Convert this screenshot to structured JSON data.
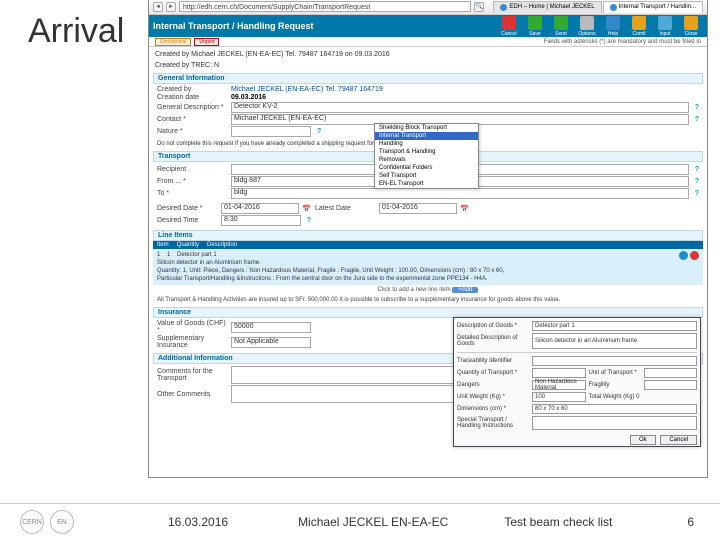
{
  "slide": {
    "title": "Arrival"
  },
  "browser": {
    "url": "http://edh.cern.ch/Document/SupplyChain/TransportRequest",
    "tab1": "EDH – Home | Michael JECKEL",
    "tab2": "Internal Transport / Handlin...",
    "pageTitle": "Internal Transport / Handling Request"
  },
  "toolbarButtons": [
    "Cancel",
    "Save",
    "Send",
    "Options",
    "Help",
    "Comfi",
    "Input",
    "Close"
  ],
  "legend": {
    "confidential": "Confidential",
    "urgent": "Urgent",
    "hint": "Fields with asterisks (*) are mandatory and must be filled in"
  },
  "createdLine": "Created by Michael JECKEL (EN-EA-EC)  Tel. 79487 164719 on 09.03.2016",
  "createdByTrec": "Created by TREC: N",
  "sections": {
    "general": "General Information",
    "transport": "Transport",
    "lineItems": "Line Items",
    "insurance": "Insurance",
    "additional": "Additional Information"
  },
  "general": {
    "createdByLabel": "Created by",
    "createdByVal": "Michael JECKEL (EN-EA-EC) Tel. 79487 164719",
    "creationDateLabel": "Creation date",
    "creationDateVal": "09.03.2016",
    "generalDescLabel": "General Description *",
    "generalDescVal": "Detector KV-2",
    "contactLabel": "Contact *",
    "contactVal": "Michael JECKEL (EN-EA-EC)",
    "natureLabel": "Nature *",
    "natureNote": "Do not complete this request if you have already completed a shipping request for the same goods."
  },
  "natureOptions": [
    "Shielding Block Transport",
    "Internal Transport",
    "Handling",
    "Transport & Handling",
    "Removals",
    "Confidential Folders",
    "Self Transport",
    "EN-EL Transport"
  ],
  "natureSelectedIndex": 1,
  "transport": {
    "recipientLabel": "Recipient",
    "fromLabel": "From ... *",
    "fromVal": "bldg 887",
    "toLabel": "To *",
    "toVal": "bldg",
    "desiredDateLabel": "Desired Date *",
    "desiredDateVal": "01-04-2016",
    "latestDateLabel": "Latest Date",
    "latestDateVal": "01-04-2016",
    "desiredTimeLabel": "Desired Time",
    "desiredTimeVal": "8:30"
  },
  "lineItems": {
    "cols": [
      "Item",
      "Quantity",
      "Description"
    ],
    "row": {
      "item": "1",
      "qty": "1",
      "desc1": "Detector part 1",
      "desc2": "Silicon detector in an Aluminium frame.",
      "desc3": "Quantity: 1, Unit: Piece, Dangers : Non Hazardous Material, Fragile : Fragile, Unit Weight : 100.00, Dimensions (cm) : 80 x 70 x 60,",
      "desc4": "Particular Transport/Handling &Instructions : From the central door on the Jura side to the experimental zone PPE134 - H4A."
    },
    "addHint": "Click to add a new line item",
    "addBtn": "+Add"
  },
  "insurance": {
    "note": "All Transport & Handling Activities are insured up to SFr. 500,000.00 It is possible to subscribe to a supplementary insurance for goods above this value.",
    "valueLabel": "Value of Goods (CHF) *",
    "valueVal": "50000",
    "suppLabel": "Supplementary Insurance",
    "suppVal": "Not Applicable"
  },
  "additional": {
    "commentsTransportLabel": "Comments for the Transport",
    "otherCommentsLabel": "Other Comments"
  },
  "dialog": {
    "descGoodsLabel": "Description of Goods *",
    "descGoodsVal": "Detector part 1",
    "detailedLabel": "Detailed Description of Goods",
    "detailedVal": "Silicon detector in an Aluminium frame",
    "traceLabel": "Traceability Identifier",
    "qtyLabel": "Quantity of Transport *",
    "dangersLabel": "Dangers",
    "dangersVal": "Non Hazardous Material",
    "fragilityLabel": "Fragility",
    "weightLabel": "Unit Weight (Kg) *",
    "weightVal": "100",
    "totWeightLabel": "Total Weight (Kg) 0",
    "dimLabel": "Dimensions (cm) *",
    "dimVal": "80  x  70  x  60",
    "unitTransportLabel": "Unit of Transport *",
    "specialLabel": "Special Transport / Handling Instructions",
    "ok": "Ok",
    "cancel": "Cancel"
  },
  "footer": {
    "date": "16.03.2016",
    "author": "Michael JECKEL EN-EA-EC",
    "topic": "Test beam check list",
    "page": "6"
  }
}
